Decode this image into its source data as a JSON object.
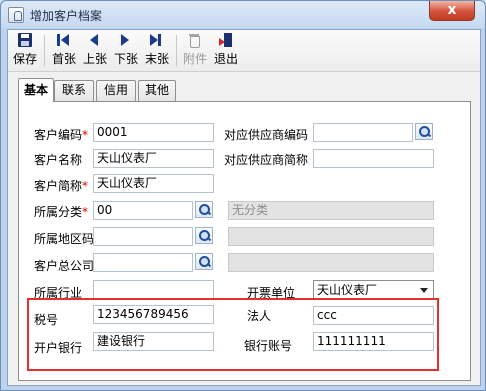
{
  "window": {
    "title": "增加客户档案",
    "close_glyph": "x"
  },
  "toolbar": {
    "save": "保存",
    "first": "首张",
    "prev": "上张",
    "next": "下张",
    "last": "末张",
    "attachment": "附件",
    "exit": "退出"
  },
  "tabs": [
    {
      "label": "基本",
      "active": true
    },
    {
      "label": "联系",
      "active": false
    },
    {
      "label": "信用",
      "active": false
    },
    {
      "label": "其他",
      "active": false
    }
  ],
  "form": {
    "customer_code": {
      "label": "客户编码",
      "required": "*",
      "value": "0001"
    },
    "customer_name": {
      "label": "客户名称",
      "value": "天山仪表厂"
    },
    "customer_short": {
      "label": "客户简称",
      "required": "*",
      "value": "天山仪表厂"
    },
    "category": {
      "label": "所属分类",
      "required": "*",
      "value": "00",
      "desc": "无分类"
    },
    "region": {
      "label": "所属地区码",
      "value": "",
      "desc": ""
    },
    "parent_company": {
      "label": "客户总公司",
      "value": "",
      "desc": ""
    },
    "industry": {
      "label": "所属行业",
      "value": ""
    },
    "supplier_code": {
      "label": "对应供应商编码",
      "value": ""
    },
    "supplier_short": {
      "label": "对应供应商简称",
      "value": ""
    },
    "invoice_unit": {
      "label": "开票单位",
      "value": "天山仪表厂"
    },
    "tax_no": {
      "label": "税号",
      "value": "123456789456"
    },
    "legal_person": {
      "label": "法人",
      "value": "ccc"
    },
    "bank": {
      "label": "开户银行",
      "value": "建设银行"
    },
    "bank_account": {
      "label": "银行账号",
      "value": "111111111"
    }
  },
  "colors": {
    "highlight_border": "#e53030",
    "required_mark": "#e00000"
  }
}
